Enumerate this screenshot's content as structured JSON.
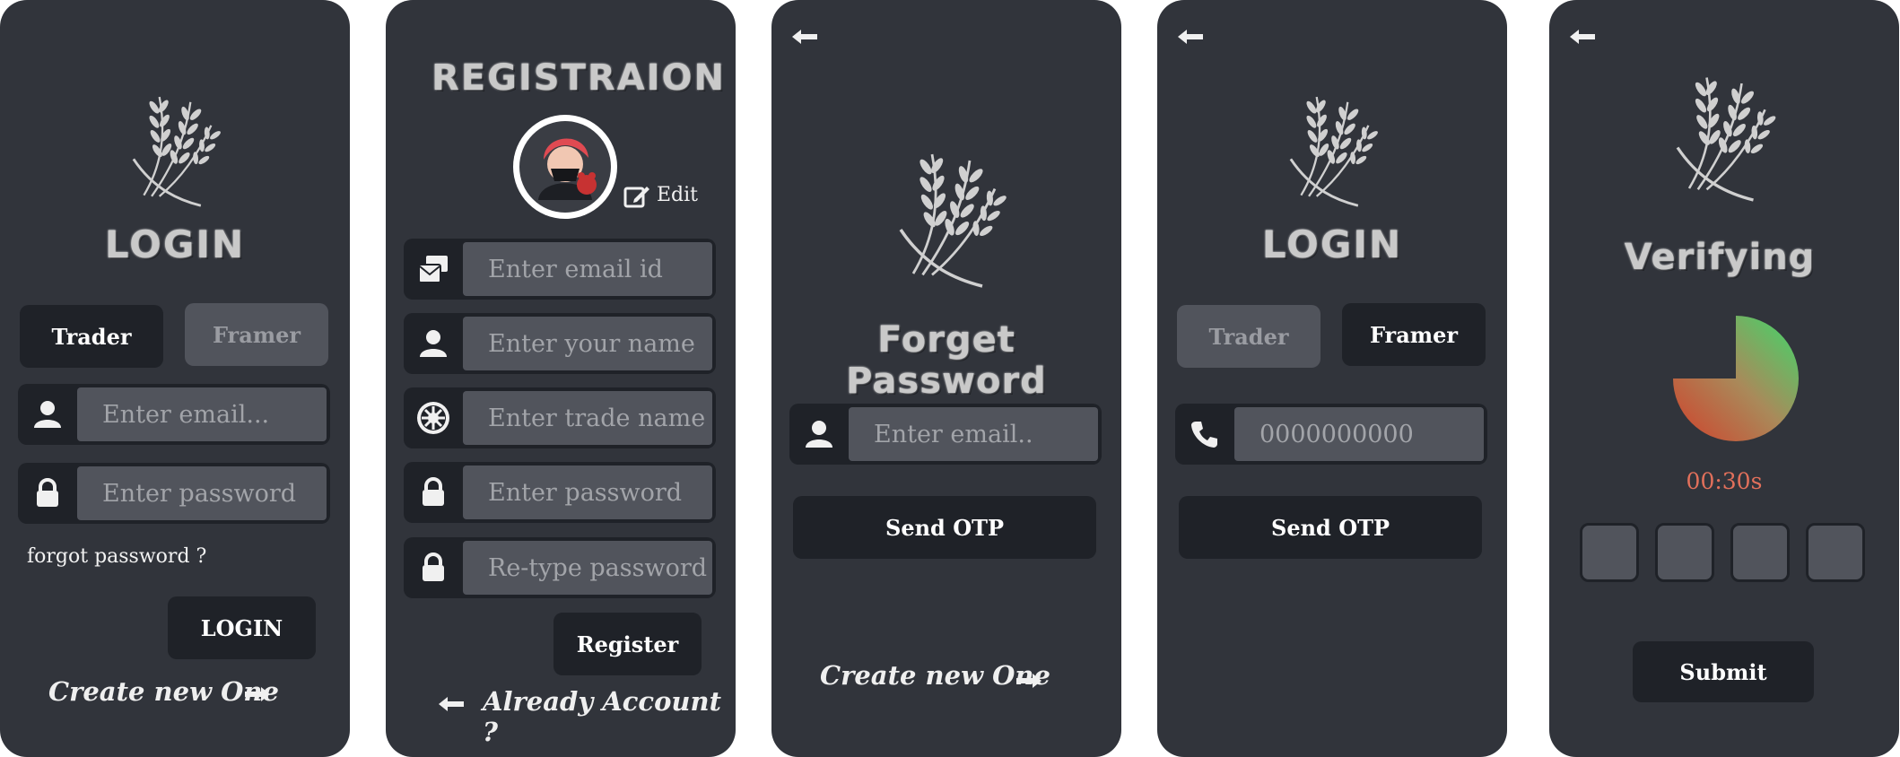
{
  "colors": {
    "background": "#31343b",
    "dark": "#1f2228",
    "input": "#51545c",
    "placeholder": "#a2a4a9",
    "timer": "#e2705b"
  },
  "login_trader": {
    "title": "LOGIN",
    "tabs": {
      "trader": "Trader",
      "framer": "Framer"
    },
    "email_placeholder": "Enter email...",
    "password_placeholder": "Enter password",
    "forgot_label": "forgot password ?",
    "login_button": "LOGIN",
    "create_link": "Create new One"
  },
  "registration": {
    "title": "REGISTRAION",
    "edit_label": "Edit",
    "email_placeholder": "Enter email id",
    "name_placeholder": "Enter your name",
    "trade_placeholder": "Enter trade name",
    "password_placeholder": "Enter password",
    "retype_placeholder": "Re-type password",
    "register_button": "Register",
    "already_link": "Already Account ?"
  },
  "forget_password": {
    "title": "Forget Password",
    "email_placeholder": "Enter email..",
    "send_button": "Send OTP",
    "create_link": "Create new One"
  },
  "login_framer": {
    "title": "LOGIN",
    "tabs": {
      "trader": "Trader",
      "framer": "Framer"
    },
    "phone_placeholder": "0000000000",
    "send_button": "Send OTP"
  },
  "verifying": {
    "title": "Verifying",
    "timer": "00:30s",
    "progress_fraction": 0.75,
    "submit_button": "Submit"
  },
  "icons": [
    "wheat-logo-icon",
    "user-icon",
    "lock-icon",
    "mail-icon",
    "gear-icon",
    "phone-icon",
    "arrow-left-icon",
    "arrow-right-icon",
    "edit-icon",
    "avatar"
  ]
}
